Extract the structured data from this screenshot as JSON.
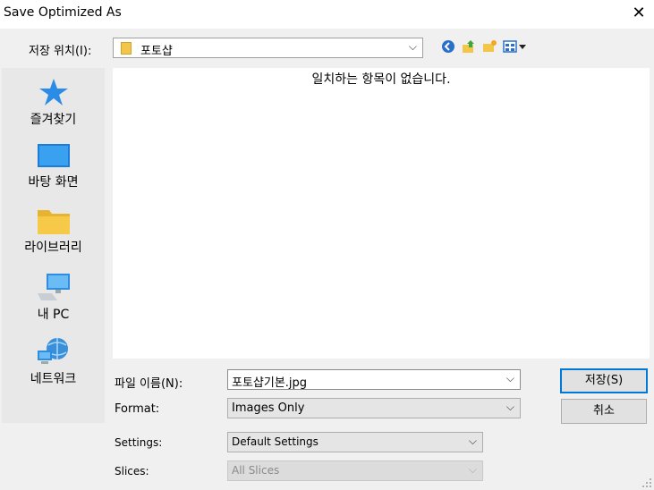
{
  "window": {
    "title": "Save Optimized As",
    "close_glyph": "✕"
  },
  "location": {
    "label": "저장 위치(I):",
    "value": "포토샵"
  },
  "toolbar": {
    "icons": [
      "back-icon",
      "up-folder-icon",
      "new-folder-icon",
      "view-menu-icon"
    ]
  },
  "sidebar": {
    "items": [
      {
        "label": "즐겨찾기",
        "icon": "star-icon"
      },
      {
        "label": "바탕 화면",
        "icon": "desktop-icon"
      },
      {
        "label": "라이브러리",
        "icon": "library-folder-icon"
      },
      {
        "label": "내 PC",
        "icon": "computer-icon"
      },
      {
        "label": "네트워크",
        "icon": "network-icon"
      }
    ]
  },
  "file_list": {
    "empty_message": "일치하는 항목이 없습니다."
  },
  "form": {
    "filename_label": "파일 이름(N):",
    "filename_value": "포토샵기본.jpg",
    "format_label": "Format:",
    "format_value": "Images Only",
    "settings_label": "Settings:",
    "settings_value": "Default Settings",
    "slices_label": "Slices:",
    "slices_value": "All Slices"
  },
  "buttons": {
    "save": "저장(S)",
    "cancel": "취소"
  },
  "colors": {
    "accent": "#0078d7",
    "sidebar_bg": "#e8e8e8",
    "window_bg": "#f0f0f0"
  }
}
